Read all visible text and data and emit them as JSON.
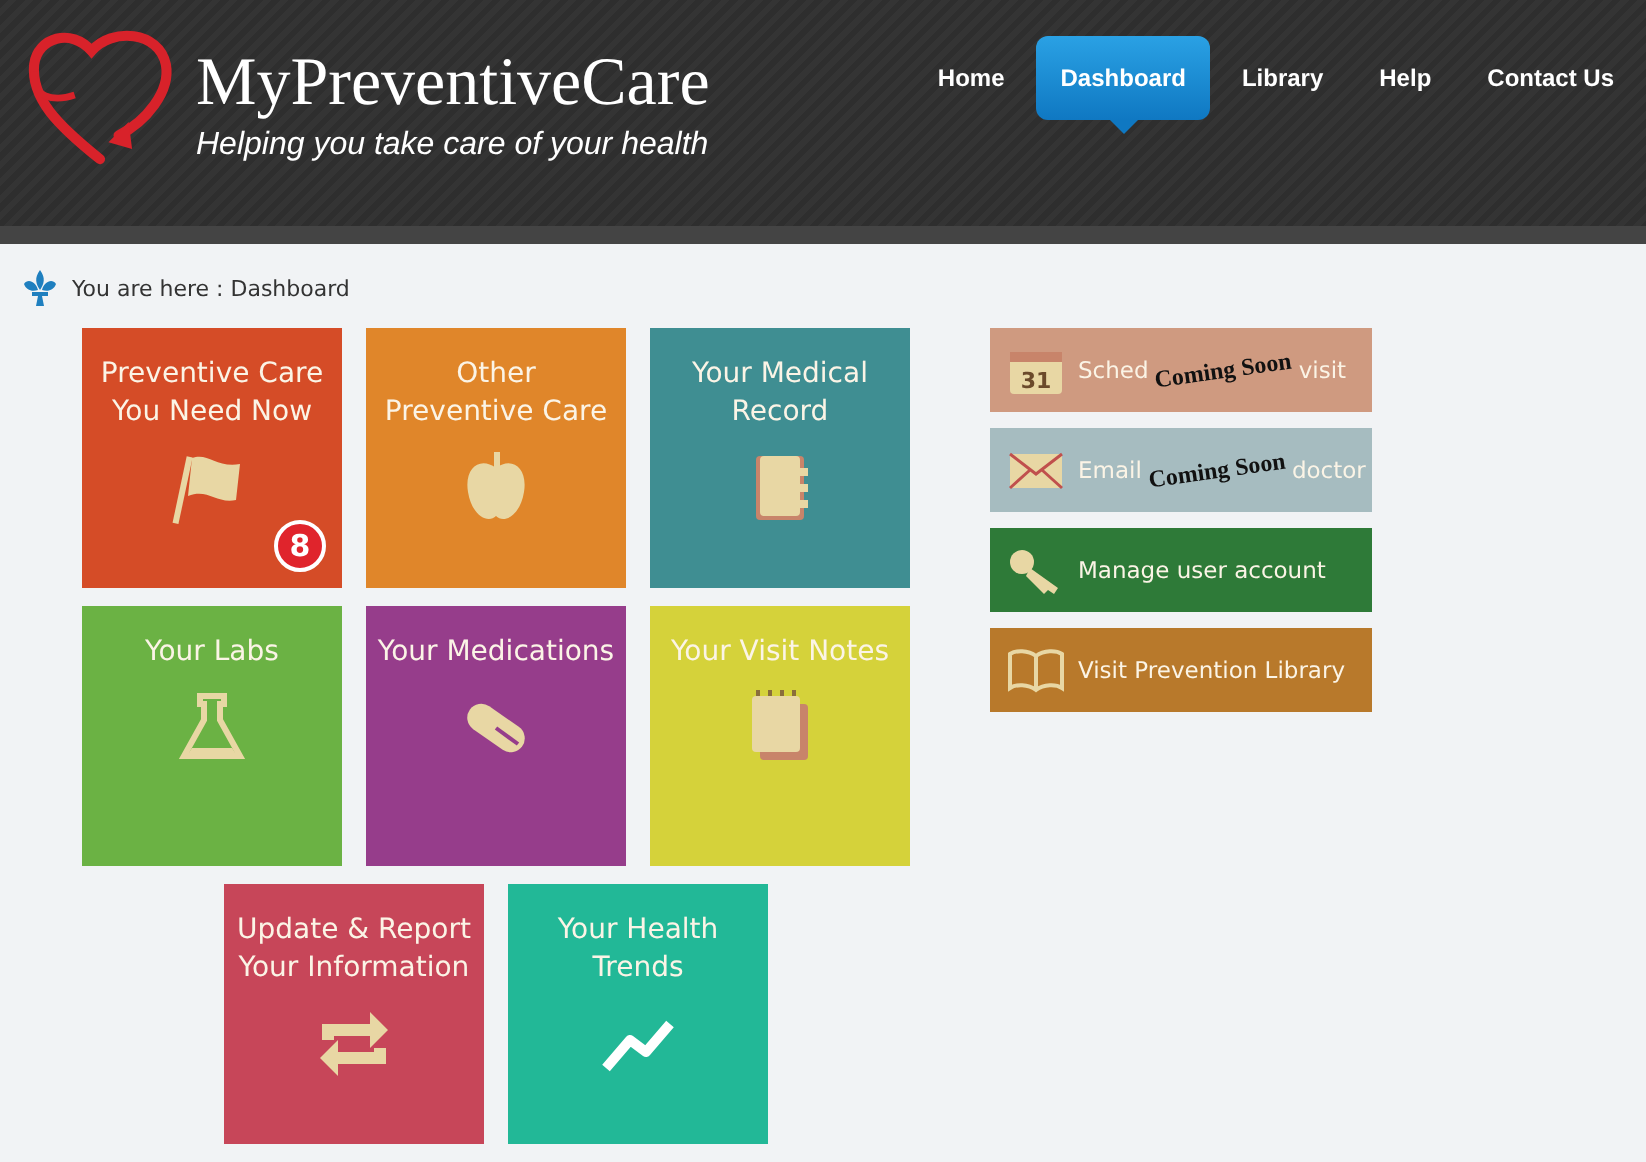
{
  "site": {
    "title": "MyPreventiveCare",
    "tagline": "Helping you take care of your health"
  },
  "nav": [
    {
      "label": "Home",
      "selected": false
    },
    {
      "label": "Dashboard",
      "selected": true
    },
    {
      "label": "Library",
      "selected": false
    },
    {
      "label": "Help",
      "selected": false
    },
    {
      "label": "Contact Us",
      "selected": false
    }
  ],
  "breadcrumb": "You are here : Dashboard",
  "tiles": [
    {
      "lines": [
        "Preventive Care",
        "You Need Now"
      ],
      "kind": "flag",
      "color": "#d54c27",
      "badge": "8"
    },
    {
      "lines": [
        "Other",
        "Preventive Care"
      ],
      "kind": "apple",
      "color": "#e0862a"
    },
    {
      "lines": [
        "Your Medical",
        "Record"
      ],
      "kind": "notebook",
      "color": "#3f8e92"
    },
    {
      "lines": [
        "Your Labs"
      ],
      "kind": "flask",
      "color": "#6bb244"
    },
    {
      "lines": [
        "Your Medications"
      ],
      "kind": "pill",
      "color": "#963d8b"
    },
    {
      "lines": [
        "Your Visit Notes"
      ],
      "kind": "notes",
      "color": "#d5d23a"
    },
    {
      "lines": [
        "Update & Report",
        "Your Information"
      ],
      "kind": "arrows",
      "color": "#c74659"
    },
    {
      "lines": [
        "Your Health",
        "Trends"
      ],
      "kind": "trend",
      "color": "#22b897"
    }
  ],
  "actions": [
    {
      "parts": [
        "Sched",
        "visit"
      ],
      "kind": "calendar",
      "icon_text": "31",
      "color": "#cf9a80",
      "stamp": "Coming Soon"
    },
    {
      "parts": [
        "Email",
        "doctor"
      ],
      "kind": "envelope",
      "color": "#a6bcc0",
      "stamp": "Coming Soon"
    },
    {
      "parts": [
        "Manage user account"
      ],
      "kind": "key",
      "color": "#2e7a38"
    },
    {
      "parts": [
        "Visit Prevention Library"
      ],
      "kind": "book",
      "color": "#b8792b"
    }
  ]
}
